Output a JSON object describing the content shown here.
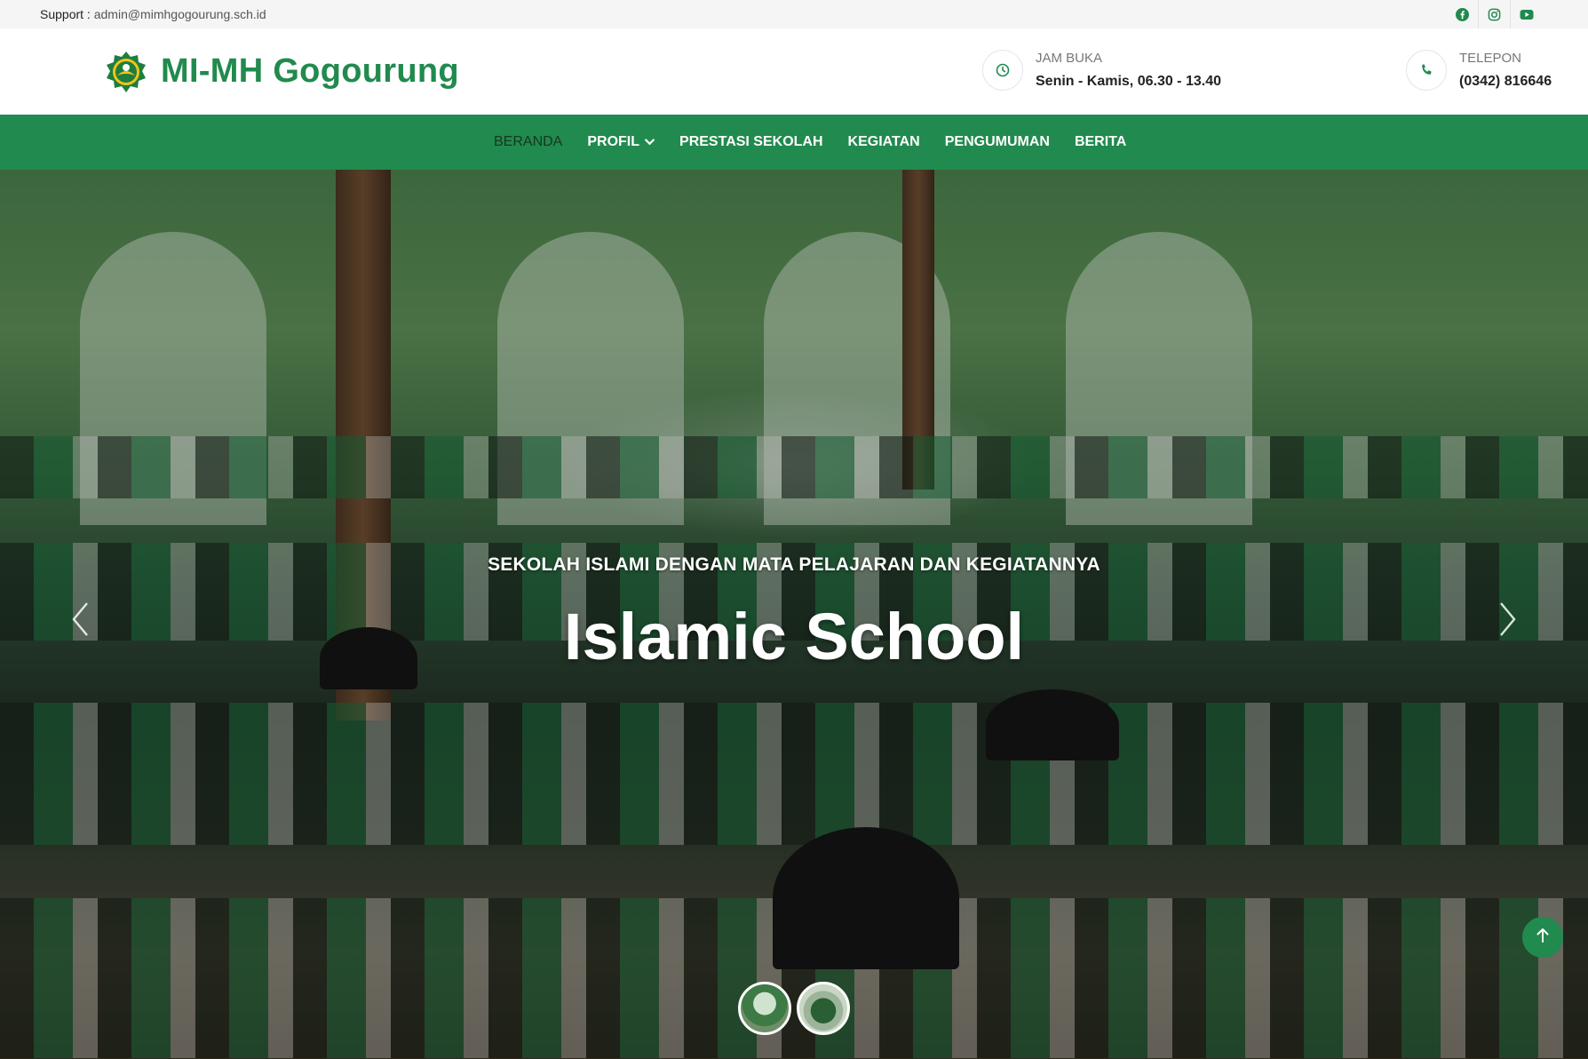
{
  "topbar": {
    "support_label": "Support :",
    "support_email": "admin@mimhgogourung.sch.id",
    "socials": [
      "facebook-icon",
      "instagram-icon",
      "youtube-icon"
    ]
  },
  "header": {
    "brand": "MI-MH Gogourung",
    "hours_label": "JAM BUKA",
    "hours_value": "Senin - Kamis, 06.30 - 13.40",
    "phone_label": "TELEPON",
    "phone_value": "(0342) 816646"
  },
  "nav": {
    "items": [
      {
        "label": "BERANDA",
        "active": true
      },
      {
        "label": "PROFIL",
        "dropdown": true
      },
      {
        "label": "PRESTASI SEKOLAH"
      },
      {
        "label": "KEGIATAN"
      },
      {
        "label": "PENGUMUMAN"
      },
      {
        "label": "BERITA"
      }
    ]
  },
  "hero": {
    "subtitle": "SEKOLAH ISLAMI DENGAN MATA PELAJARAN DAN KEGIATANNYA",
    "title": "Islamic School",
    "slides": 2
  },
  "colors": {
    "brand_green": "#218a4e",
    "nav_active": "#14381f",
    "topbar_bg": "#f5f5f5"
  }
}
